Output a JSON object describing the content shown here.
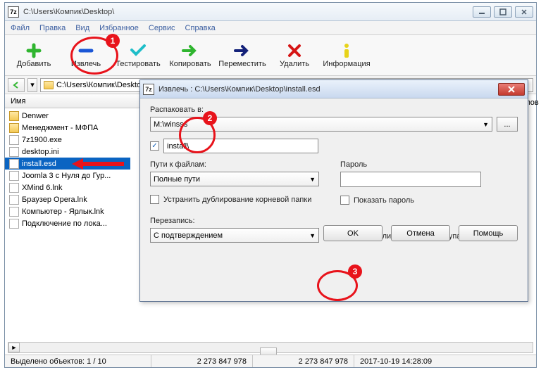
{
  "window": {
    "app_icon_text": "7z",
    "title": "C:\\Users\\Компик\\Desktop\\"
  },
  "menu": {
    "file": "Файл",
    "edit": "Правка",
    "view": "Вид",
    "favorites": "Избранное",
    "tools": "Сервис",
    "help": "Справка"
  },
  "toolbar": {
    "add": "Добавить",
    "extract": "Извлечь",
    "test": "Тестировать",
    "copy": "Копировать",
    "move": "Переместить",
    "delete": "Удалить",
    "info": "Информация"
  },
  "address": {
    "path": "C:\\Users\\Компик\\Desktop\\"
  },
  "columns": {
    "name": "Имя",
    "cut_right": "айлов"
  },
  "files": [
    {
      "name": "Denwer",
      "type": "folder"
    },
    {
      "name": "Менеджмент - МФПА",
      "type": "folder"
    },
    {
      "name": "7z1900.exe",
      "type": "exe"
    },
    {
      "name": "desktop.ini",
      "type": "ini"
    },
    {
      "name": "install.esd",
      "type": "esd",
      "selected": true
    },
    {
      "name": "Joomla 3 с Нуля до Гур...",
      "type": "file"
    },
    {
      "name": "XMind 6.lnk",
      "type": "file"
    },
    {
      "name": "Браузер Opera.lnk",
      "type": "file"
    },
    {
      "name": "Компьютер - Ярлык.lnk",
      "type": "file"
    },
    {
      "name": "Подключение по лока...",
      "type": "file"
    }
  ],
  "dialog": {
    "title": "Извлечь : C:\\Users\\Компик\\Desktop\\install.esd",
    "extract_to_label": "Распаковать в:",
    "extract_to_value": "M:\\winsss",
    "subfolder_checked": true,
    "subfolder_value": "install\\",
    "paths_label": "Пути к файлам:",
    "paths_value": "Полные пути",
    "eliminate_dup": "Устранить дублирование корневой папки",
    "eliminate_dup_checked": false,
    "overwrite_label": "Перезапись:",
    "overwrite_value": "С подтверждением",
    "password_label": "Пароль",
    "show_password": "Показать пароль",
    "show_password_checked": false,
    "restore_security": "Устанавливать права доступа",
    "restore_security_checked": false,
    "ok": "OK",
    "cancel": "Отмена",
    "help": "Помощь"
  },
  "status": {
    "selection": "Выделено объектов: 1 / 10",
    "size1": "2 273 847 978",
    "size2": "2 273 847 978",
    "date": "2017-10-19 14:28:09"
  },
  "annotations": {
    "n1": "1",
    "n2": "2",
    "n3": "3"
  }
}
